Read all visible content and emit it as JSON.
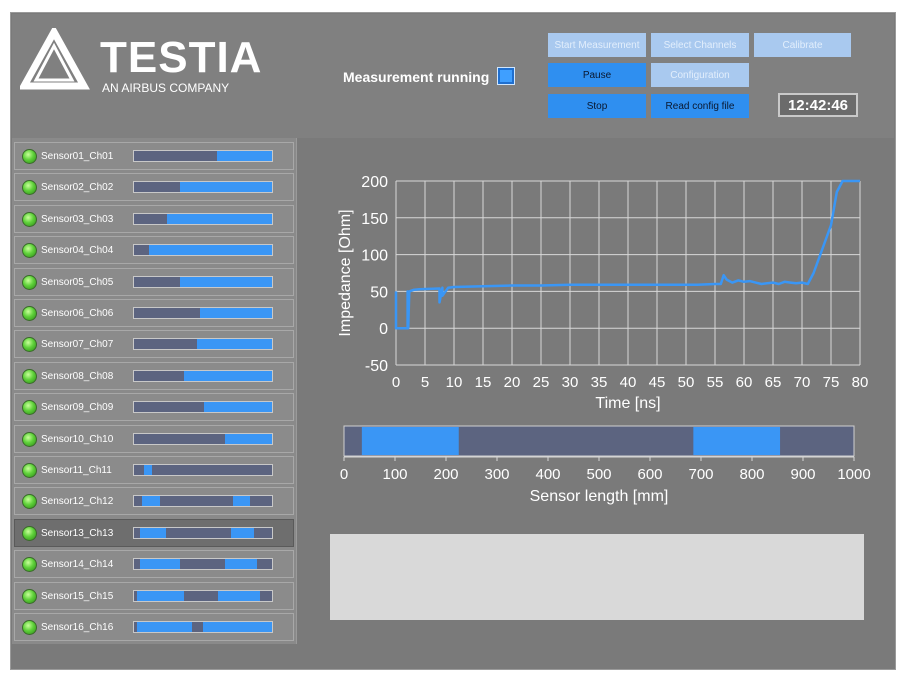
{
  "app": {
    "logo_text": "TESTIA",
    "logo_sub": "AN AIRBUS COMPANY"
  },
  "status": {
    "running_label": "Measurement running",
    "clock": "12:42:46"
  },
  "buttons": {
    "start": "Start Measurement",
    "select": "Select Channels",
    "calibrate": "Calibrate",
    "pause": "Pause",
    "configuration": "Configuration",
    "stop": "Stop",
    "read_config": "Read config file"
  },
  "colors": {
    "accent": "#3a96f5",
    "bar_background": "#5c6480",
    "panel": "#7a7a7a",
    "led": "#5fd13a"
  },
  "sensors": [
    {
      "label": "Sensor01_Ch01",
      "segments": [
        [
          0.6,
          1.0
        ]
      ]
    },
    {
      "label": "Sensor02_Ch02",
      "segments": [
        [
          0.33,
          1.0
        ]
      ]
    },
    {
      "label": "Sensor03_Ch03",
      "segments": [
        [
          0.24,
          1.0
        ]
      ]
    },
    {
      "label": "Sensor04_Ch04",
      "segments": [
        [
          0.11,
          1.0
        ]
      ]
    },
    {
      "label": "Sensor05_Ch05",
      "segments": [
        [
          0.33,
          1.0
        ]
      ]
    },
    {
      "label": "Sensor06_Ch06",
      "segments": [
        [
          0.48,
          1.0
        ]
      ]
    },
    {
      "label": "Sensor07_Ch07",
      "segments": [
        [
          0.46,
          1.0
        ]
      ]
    },
    {
      "label": "Sensor08_Ch08",
      "segments": [
        [
          0.36,
          1.0
        ]
      ]
    },
    {
      "label": "Sensor09_Ch09",
      "segments": [
        [
          0.51,
          1.0
        ]
      ]
    },
    {
      "label": "Sensor10_Ch10",
      "segments": [
        [
          0.66,
          1.0
        ]
      ]
    },
    {
      "label": "Sensor11_Ch11",
      "segments": [
        [
          0.07,
          0.13
        ]
      ]
    },
    {
      "label": "Sensor12_Ch12",
      "segments": [
        [
          0.06,
          0.19
        ],
        [
          0.72,
          0.84
        ]
      ]
    },
    {
      "label": "Sensor13_Ch13",
      "segments": [
        [
          0.04,
          0.23
        ],
        [
          0.7,
          0.87
        ]
      ],
      "selected": true
    },
    {
      "label": "Sensor14_Ch14",
      "segments": [
        [
          0.04,
          0.33
        ],
        [
          0.66,
          0.89
        ]
      ]
    },
    {
      "label": "Sensor15_Ch15",
      "segments": [
        [
          0.02,
          0.36
        ],
        [
          0.61,
          0.91
        ]
      ]
    },
    {
      "label": "Sensor16_Ch16",
      "segments": [
        [
          0.02,
          0.42
        ],
        [
          0.5,
          1.0
        ]
      ]
    }
  ],
  "chart_data": [
    {
      "type": "line",
      "xlabel": "Time [ns]",
      "ylabel": "Impedance [Ohm]",
      "xlim": [
        0,
        80
      ],
      "ylim": [
        -50,
        200
      ],
      "xticks": [
        0,
        5,
        10,
        15,
        20,
        25,
        30,
        35,
        40,
        45,
        50,
        55,
        60,
        65,
        70,
        75,
        80
      ],
      "yticks": [
        -50,
        0,
        50,
        100,
        150,
        200
      ],
      "grid": true,
      "series": [
        {
          "color": "#3a96f5",
          "x": [
            0,
            0,
            2,
            2,
            2.1,
            2.3,
            3,
            4,
            7.5,
            7.5,
            8,
            8,
            9,
            10,
            15,
            20,
            25,
            30,
            35,
            40,
            45,
            50,
            52,
            55,
            56,
            56.5,
            57,
            58,
            59,
            60,
            61,
            62,
            63,
            64,
            65,
            66,
            67,
            68,
            69,
            70,
            71,
            72,
            75,
            76,
            77,
            78,
            80
          ],
          "y": [
            50,
            0,
            0,
            50,
            0,
            50,
            52,
            53,
            54,
            35,
            55,
            44,
            55,
            56,
            57,
            58,
            58,
            59,
            59,
            59,
            59,
            59,
            59,
            60,
            60,
            72,
            66,
            62,
            65,
            63,
            64,
            62,
            60,
            61,
            62,
            60,
            63,
            62,
            61,
            62,
            60,
            75,
            140,
            185,
            200,
            200,
            200
          ]
        }
      ]
    },
    {
      "type": "bar",
      "xlabel": "Sensor length [mm]",
      "xlim": [
        0,
        1000
      ],
      "xticks": [
        0,
        100,
        200,
        300,
        400,
        500,
        600,
        700,
        800,
        900,
        1000
      ],
      "segments": [
        [
          35,
          225
        ],
        [
          685,
          855
        ]
      ]
    }
  ]
}
